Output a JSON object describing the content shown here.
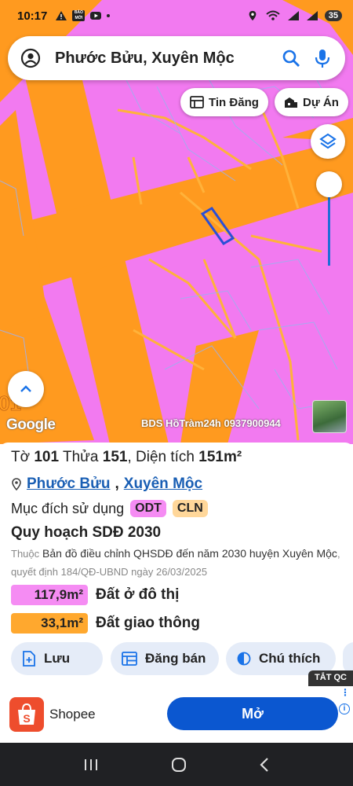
{
  "status": {
    "time": "10:17",
    "battery": "35",
    "notif_badge": "BÁO MỚI"
  },
  "search": {
    "query": "Phước Bửu, Xuyên Mộc"
  },
  "chips": {
    "listings": "Tin Đăng",
    "projects": "Dự Án"
  },
  "map": {
    "attribution": "Google",
    "watermark": "BDS HồTràm24h 0937900944",
    "colors": {
      "residential": "#f27af0",
      "road": "#ff9a1f",
      "highlight_outline": "#2a4fd6"
    }
  },
  "parcel": {
    "sheet_label": "Tờ",
    "sheet": "101",
    "lot_label": "Thửa",
    "lot": "151",
    "area_label": "Diện tích",
    "area": "151m²",
    "ward": "Phước Bửu",
    "district": "Xuyên Mộc",
    "purpose_label": "Mục đích sử dụng",
    "purposes": [
      "ODT",
      "CLN"
    ]
  },
  "plan": {
    "title": "Quy hoạch SDĐ 2030",
    "desc_prefix": "Thuộc",
    "desc_main": "Bản đồ điều chỉnh QHSDĐ đến năm 2030 huyện Xuyên Mộc",
    "desc_suffix": ", quyết định 184/QĐ-UBND ngày 26/03/2025",
    "breakdown": [
      {
        "area": "117,9m²",
        "label": "Đất ở đô thị",
        "color": "#f58cf3"
      },
      {
        "area": "33,1m²",
        "label": "Đất giao thông",
        "color": "#ffa82e"
      }
    ]
  },
  "actions": {
    "save": "Lưu",
    "post": "Đăng bán",
    "legend": "Chú thích"
  },
  "ad": {
    "hide": "TẮT QC",
    "brand": "Shopee",
    "cta": "Mở"
  }
}
